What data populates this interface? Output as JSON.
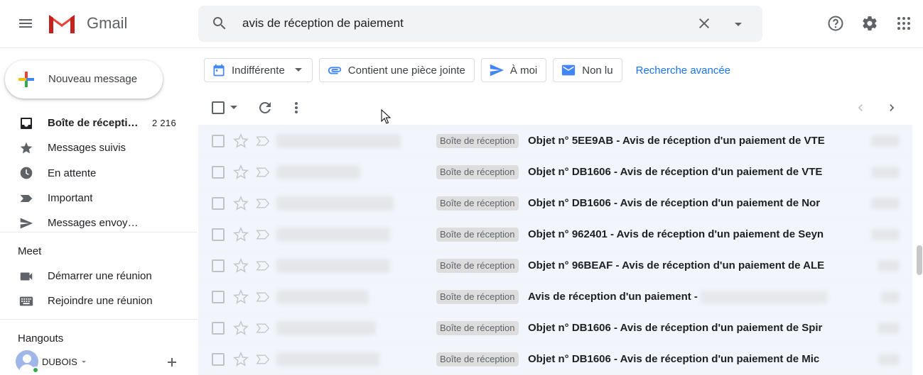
{
  "app": {
    "name": "Gmail"
  },
  "search": {
    "value": "avis de réception de paiement"
  },
  "compose": {
    "label": "Nouveau message"
  },
  "nav": {
    "items": [
      {
        "label": "Boîte de réception",
        "count": "2 216",
        "icon": "inbox-icon"
      },
      {
        "label": "Messages suivis",
        "icon": "star-icon"
      },
      {
        "label": "En attente",
        "icon": "clock-icon"
      },
      {
        "label": "Important",
        "icon": "important-icon"
      },
      {
        "label": "Messages envoyés",
        "icon": "send-icon"
      }
    ]
  },
  "meet": {
    "title": "Meet",
    "items": [
      {
        "label": "Démarrer une réunion",
        "icon": "video-camera-icon"
      },
      {
        "label": "Rejoindre une réunion",
        "icon": "keyboard-icon"
      }
    ]
  },
  "hangouts": {
    "title": "Hangouts",
    "user": "DUBOIS"
  },
  "filters": {
    "date_label": "Indifférente",
    "attachment_label": "Contient une pièce jointe",
    "to_me_label": "À moi",
    "unread_label": "Non lu",
    "advanced_label": "Recherche avancée"
  },
  "emails": [
    {
      "badge": "Boîte de réception",
      "subject": "Objet n° 5EE9AB - Avis de réception d'un paiement de VTE"
    },
    {
      "badge": "Boîte de réception",
      "subject": "Objet n° DB1606 - Avis de réception d'un paiement de VTE"
    },
    {
      "badge": "Boîte de réception",
      "subject": "Objet n° DB1606 - Avis de réception d'un paiement de Nor"
    },
    {
      "badge": "Boîte de réception",
      "subject": "Objet n° 962401 - Avis de réception d'un paiement de Seyn"
    },
    {
      "badge": "Boîte de réception",
      "subject": "Objet n° 96BEAF - Avis de réception d'un paiement de ALE"
    },
    {
      "badge": "Boîte de réception",
      "subject": "Avis de réception d'un paiement -"
    },
    {
      "badge": "Boîte de réception",
      "subject": "Objet n° DB1606 - Avis de réception d'un paiement de Spir"
    },
    {
      "badge": "Boîte de réception",
      "subject": "Objet n° DB1606 - Avis de réception d'un paiement de Mic"
    }
  ],
  "colors": {
    "accent": "#1a73e8",
    "badge_bg": "#dddddd",
    "row_bg": "#f2f6fc"
  }
}
